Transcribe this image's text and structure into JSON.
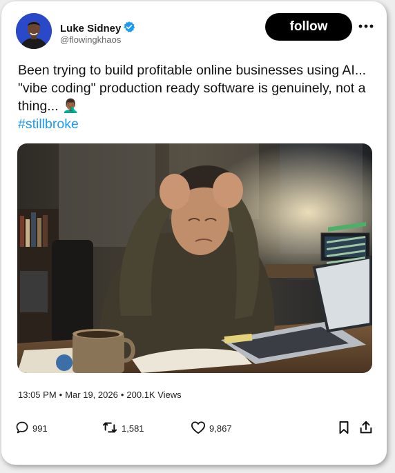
{
  "author": {
    "display_name": "Luke Sidney",
    "handle": "@flowingkhaos",
    "verified": true
  },
  "actions_top": {
    "follow_label": "follow"
  },
  "post": {
    "text": "Been trying to build profitable online businesses using AI... \"vibe coding\" production ready software is genuinely, not a thing... 🤦🏾‍♂️",
    "hashtag": "#stillbroke"
  },
  "meta": {
    "time": "13:05 PM",
    "separator": "•",
    "date": "Mar 19, 2026",
    "views": "200.1K Views"
  },
  "engagement": {
    "replies": "991",
    "reposts": "1,581",
    "likes": "9,867"
  },
  "icons": {
    "verified": "verified-badge-icon",
    "more": "more-dots-icon",
    "reply": "reply-bubble-icon",
    "repost": "repost-icon",
    "like": "heart-icon",
    "bookmark": "bookmark-icon",
    "share": "share-upload-icon"
  },
  "colors": {
    "accent": "#1d9bf0",
    "follow_bg": "#000000"
  }
}
